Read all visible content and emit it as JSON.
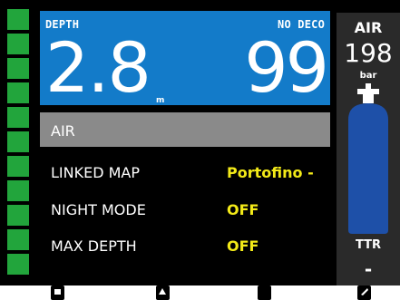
{
  "depth": {
    "label": "DEPTH",
    "value": "2.8",
    "unit": "m"
  },
  "no_deco": {
    "label": "NO DECO",
    "value": "99"
  },
  "gas": {
    "header": "AIR"
  },
  "menu": [
    {
      "label": "LINKED MAP",
      "value": "Portofino -"
    },
    {
      "label": "NIGHT MODE",
      "value": "OFF"
    },
    {
      "label": "MAX DEPTH",
      "value": "OFF"
    }
  ],
  "air_panel": {
    "title": "AIR",
    "pressure": "198",
    "unit": "bar",
    "ttr_label": "TTR",
    "ttr_value": "-"
  },
  "colors": {
    "segment_green": "#22a53c",
    "depth_panel_blue": "#137bc9",
    "gas_header_gray": "#8a8a8a",
    "value_yellow": "#f3ea18",
    "tank_blue": "#1e50a8"
  },
  "softkeys": [
    {
      "icon": "softkey-1-icon"
    },
    {
      "icon": "softkey-2-icon"
    },
    {
      "icon": "softkey-3-icon"
    },
    {
      "icon": "softkey-4-icon"
    }
  ]
}
